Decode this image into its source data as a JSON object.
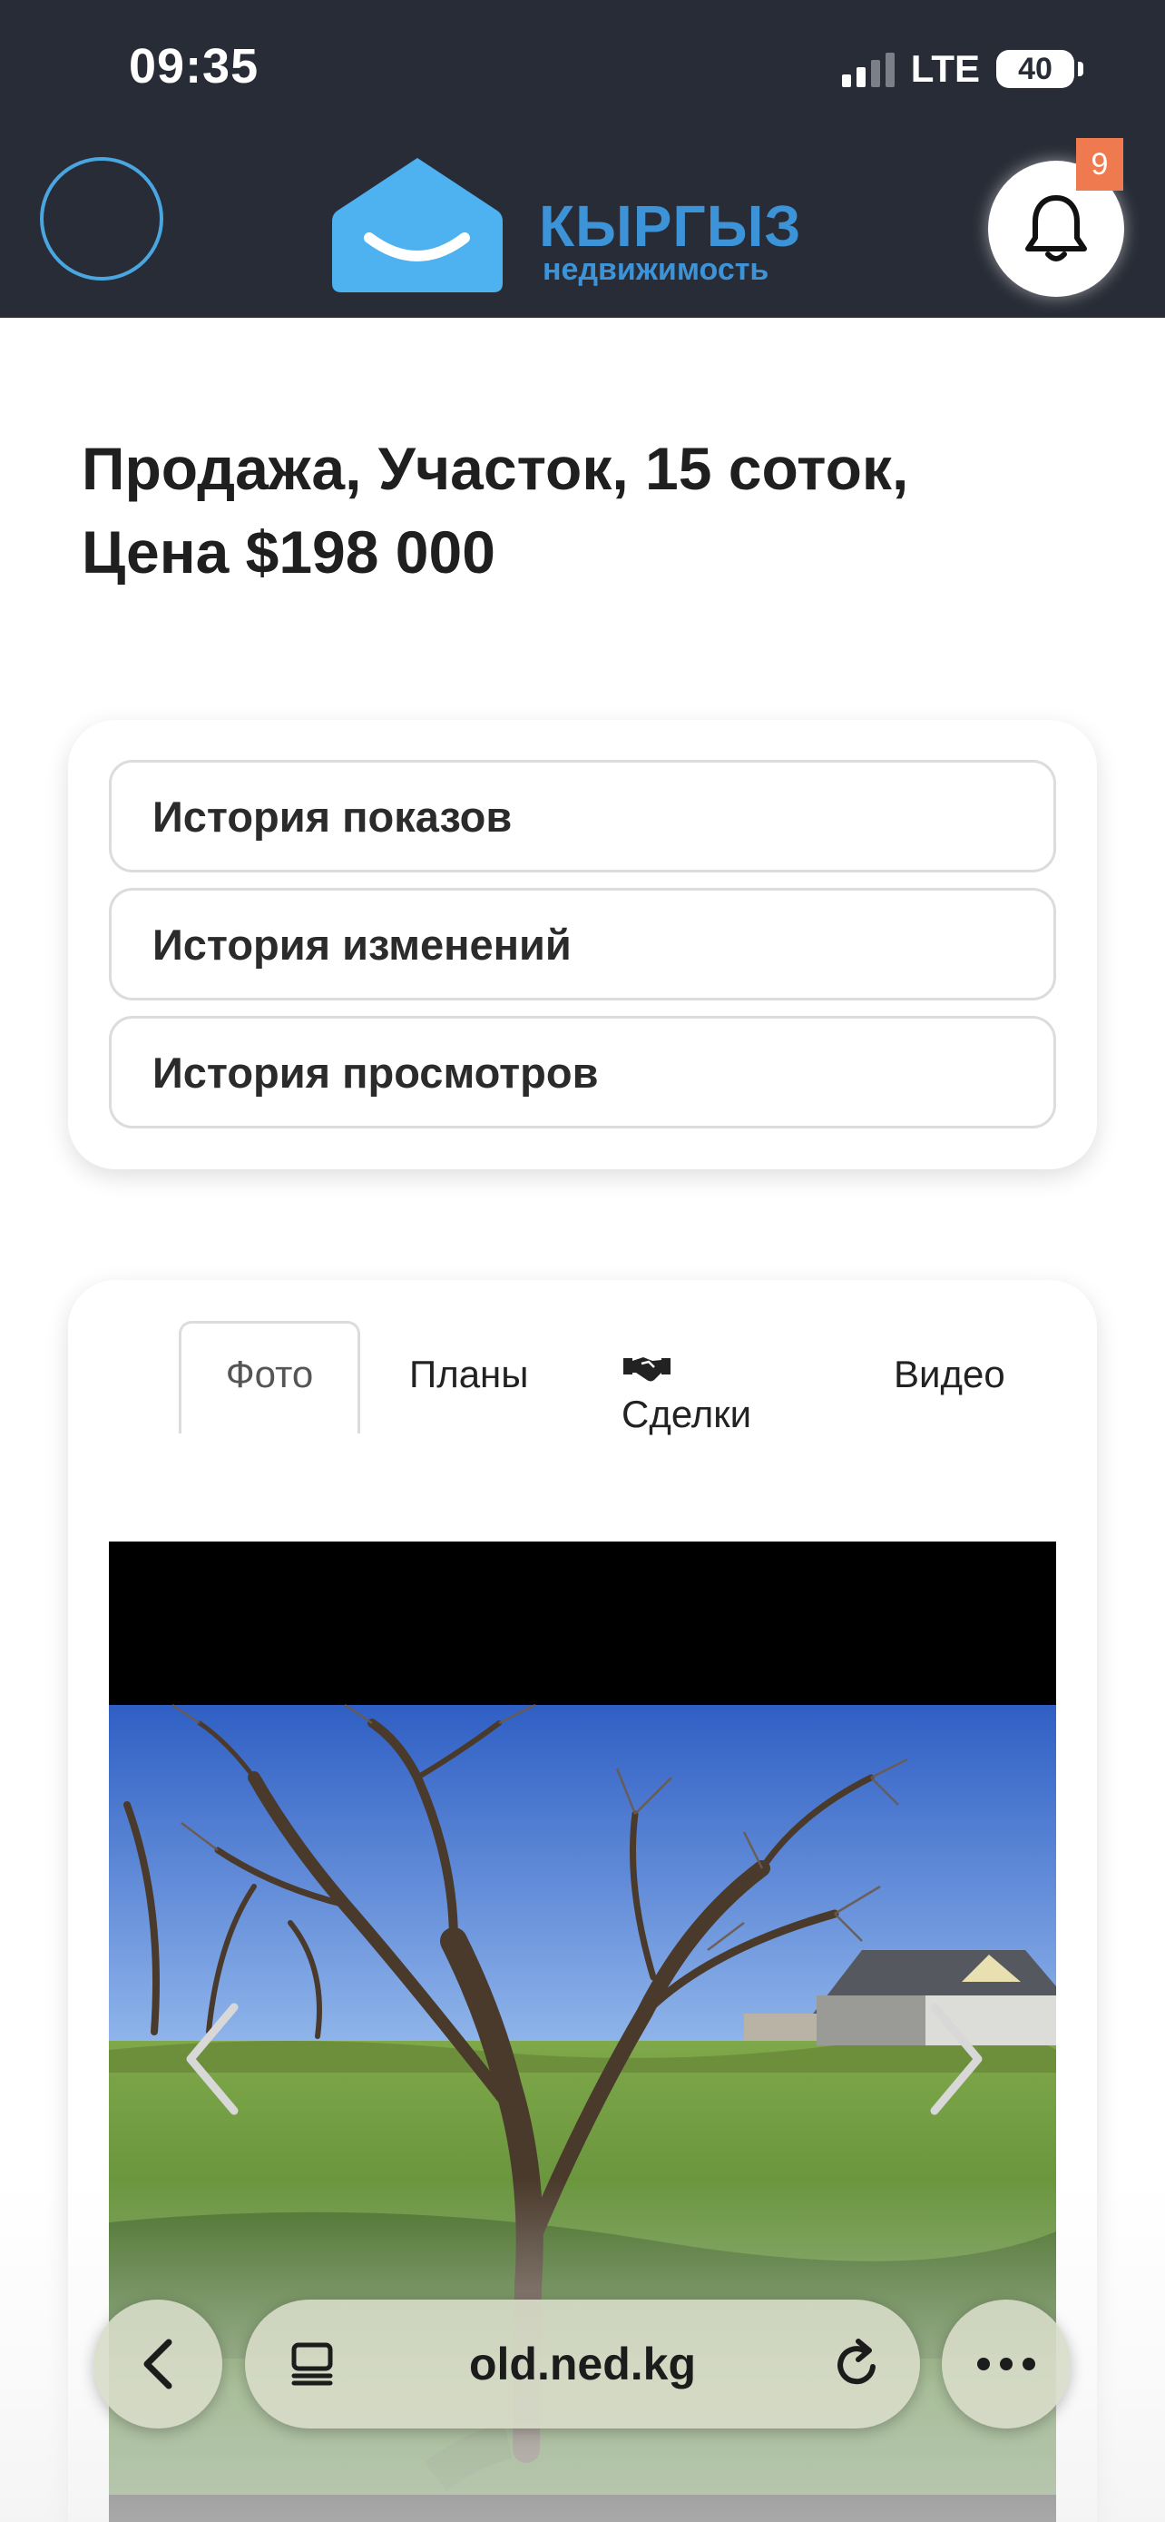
{
  "status_bar": {
    "time": "09:35",
    "network": "LTE",
    "battery": "40"
  },
  "header": {
    "logo_title": "КЫРГЫЗ",
    "logo_subtitle": "недвижимость",
    "notification_count": "9",
    "icons": [
      "menu-circle",
      "bell-icon"
    ]
  },
  "listing": {
    "title_line1": "Продажа, Участок, 15 соток,",
    "title_line2": "Цена $198 000"
  },
  "history": {
    "items": [
      "История показов",
      "История изменений",
      "История просмотров"
    ]
  },
  "media_tabs": {
    "tabs": [
      "Фото",
      "Планы",
      "Сделки",
      "Видео"
    ],
    "active": "Фото",
    "deals_icon": "handshake-icon"
  },
  "browser": {
    "url": "old.ned.kg",
    "icons": [
      "back-icon",
      "reader-icon",
      "reload-icon",
      "more-icon"
    ]
  },
  "colors": {
    "header_bg": "#282c36",
    "brand_blue": "#4fb2f0",
    "badge": "#f07a4f"
  }
}
